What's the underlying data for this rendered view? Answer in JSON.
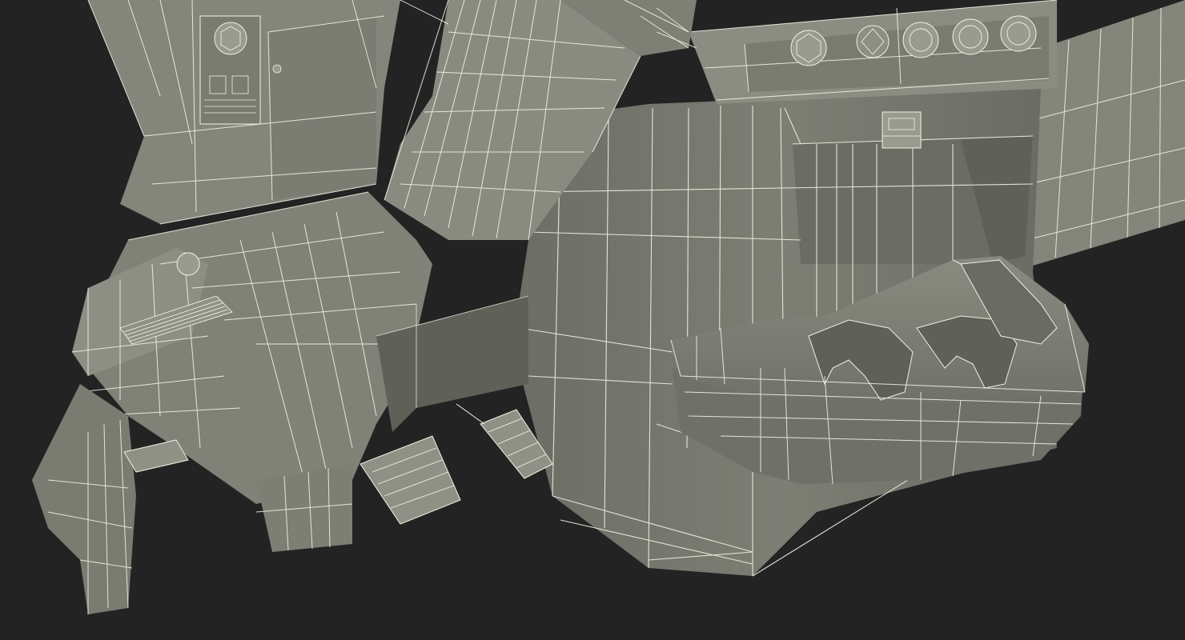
{
  "scene": {
    "subject": "wireframe-3d-render",
    "colors": {
      "background": "#232323",
      "surface": "#7b7c72",
      "surface_light": "#8e8f84",
      "surface_dark": "#5f6058",
      "surface_shadow": "#4b4c45",
      "wire": "#f2f0e2"
    }
  }
}
